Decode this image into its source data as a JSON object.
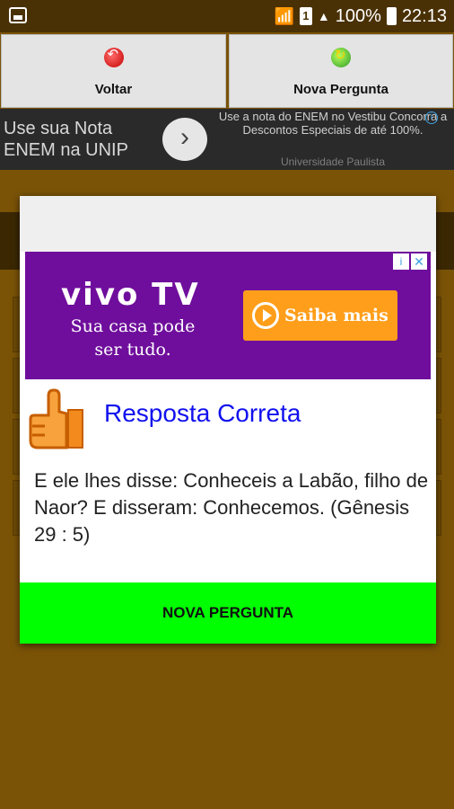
{
  "status_bar": {
    "battery": "100%",
    "time": "22:13",
    "sim": "1"
  },
  "toolbar": {
    "back_label": "Voltar",
    "new_question_label": "Nova Pergunta"
  },
  "banner_ad": {
    "title": "Use sua Nota ENEM na UNIP",
    "text": "Use a nota do ENEM no Vestibu Concorra a Descontos Especiais de até 100%.",
    "source": "Universidade Paulista",
    "info_icon": "i"
  },
  "dialog": {
    "ad": {
      "brand": "vivo TV",
      "tagline": "Sua casa pode ser tudo.",
      "cta": "Saiba mais",
      "info_icon": "i",
      "close_icon": "✕"
    },
    "result_title": "Resposta Correta",
    "answer_text": "E ele lhes disse: Conheceis a Labão, filho de Naor? E disseram: Conhecemos. (Gênesis 29 : 5)",
    "action_label": "NOVA PERGUNTA"
  },
  "colors": {
    "background": "#7a5307",
    "success_bar": "#00ff00",
    "result_text": "#1111ee",
    "ad_purple": "#6f0e9c",
    "ad_cta": "#ff9e1a"
  }
}
